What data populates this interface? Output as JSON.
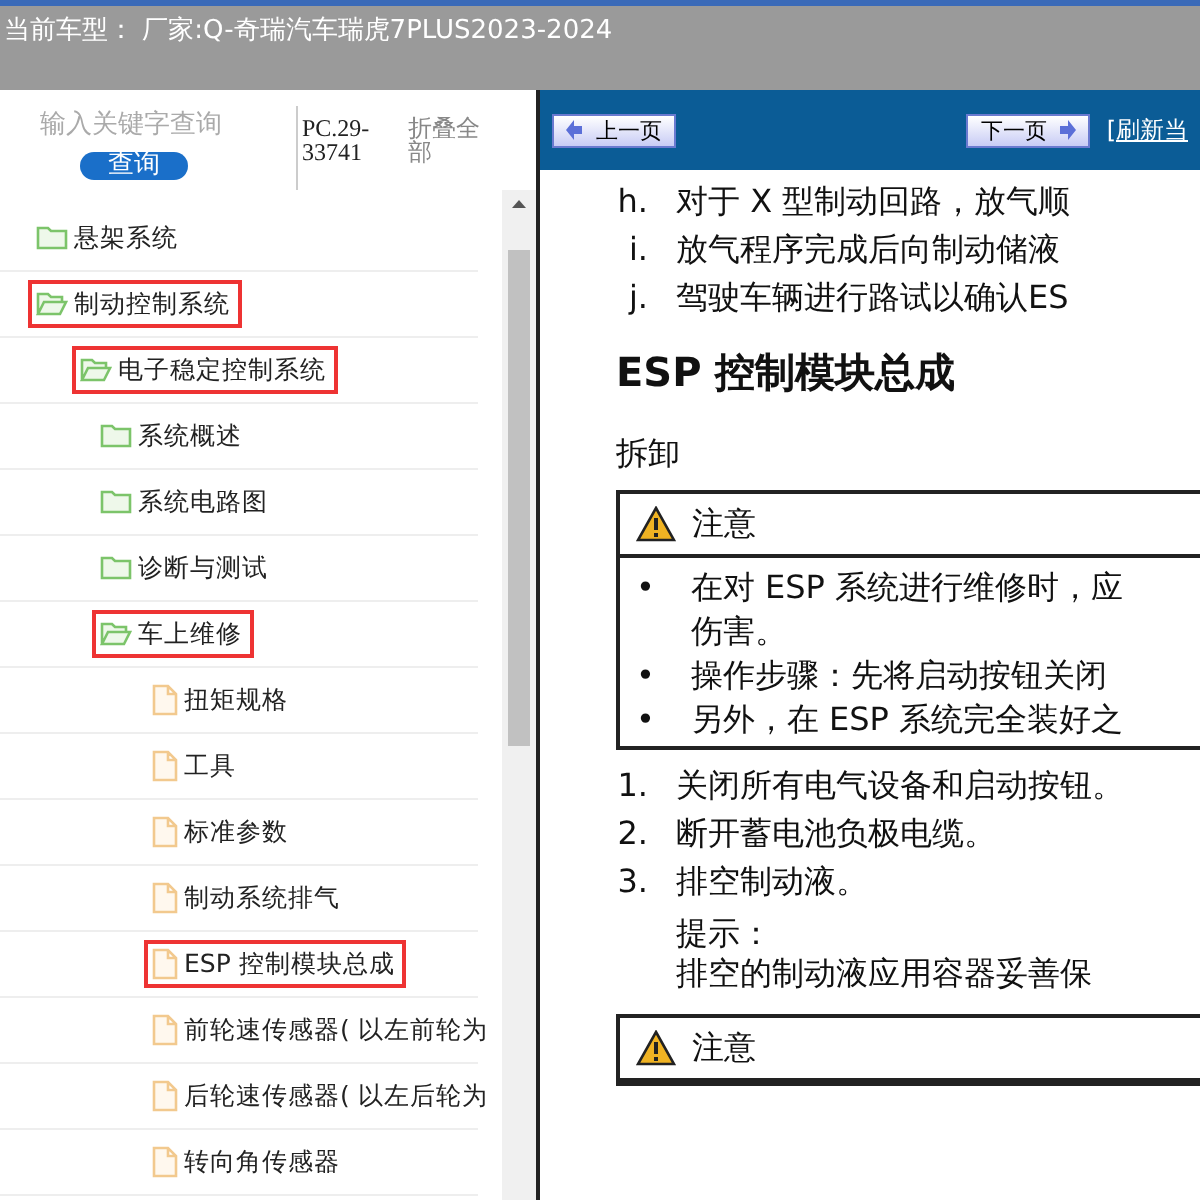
{
  "window": {
    "title": "当前车型：  厂家:Q-奇瑞汽车瑞虎7PLUS2023-2024"
  },
  "sidebar": {
    "search": {
      "placeholder": "输入关键字查询",
      "button": "查询"
    },
    "code": "PC.29-33741",
    "collapse_all": "折叠全部",
    "tree": [
      {
        "kind": "folder",
        "label": "悬架系统",
        "expanded": false,
        "highlighted": false
      },
      {
        "kind": "folder",
        "label": "制动控制系统",
        "expanded": true,
        "highlighted": true,
        "children": [
          {
            "kind": "folder",
            "label": "电子稳定控制系统",
            "expanded": true,
            "highlighted": true,
            "children": [
              {
                "kind": "folder",
                "label": "系统概述",
                "expanded": false,
                "highlighted": false
              },
              {
                "kind": "folder",
                "label": "系统电路图",
                "expanded": false,
                "highlighted": false
              },
              {
                "kind": "folder",
                "label": "诊断与测试",
                "expanded": false,
                "highlighted": false
              },
              {
                "kind": "folder",
                "label": "车上维修",
                "expanded": true,
                "highlighted": true,
                "children": [
                  {
                    "kind": "page",
                    "label": "扭矩规格",
                    "highlighted": false
                  },
                  {
                    "kind": "page",
                    "label": "工具",
                    "highlighted": false
                  },
                  {
                    "kind": "page",
                    "label": "标准参数",
                    "highlighted": false
                  },
                  {
                    "kind": "page",
                    "label": "制动系统排气",
                    "highlighted": false
                  },
                  {
                    "kind": "page",
                    "label": "ESP 控制模块总成",
                    "highlighted": true
                  },
                  {
                    "kind": "page",
                    "label": "前轮速传感器( 以左前轮为",
                    "highlighted": false
                  },
                  {
                    "kind": "page",
                    "label": "后轮速传感器( 以左后轮为",
                    "highlighted": false
                  },
                  {
                    "kind": "page",
                    "label": "转向角传感器",
                    "highlighted": false
                  }
                ]
              }
            ]
          }
        ]
      }
    ]
  },
  "toolbar": {
    "prev": "上一页",
    "next": "下一页",
    "refresh": "[刷新当"
  },
  "document": {
    "steps_before": [
      {
        "marker": "h.",
        "text": "对于 X 型制动回路，放气顺"
      },
      {
        "marker": "i.",
        "text": "放气程序完成后向制动储液"
      },
      {
        "marker": "j.",
        "text": "驾驶车辆进行路试以确认ES"
      }
    ],
    "heading": "ESP 控制模块总成",
    "section": "拆卸",
    "caution": {
      "title": "注意",
      "bullets": [
        {
          "marker": "•",
          "lines": [
            "在对 ESP 系统进行维修时，应",
            "伤害。"
          ]
        },
        {
          "marker": "•",
          "lines": [
            "操作步骤：先将启动按钮关闭"
          ]
        },
        {
          "marker": "•",
          "lines": [
            "另外，在 ESP 系统完全装好之"
          ]
        }
      ]
    },
    "steps": [
      {
        "marker": "1.",
        "text": "关闭所有电气设备和启动按钮。"
      },
      {
        "marker": "2.",
        "text": "断开蓄电池负极电缆。"
      },
      {
        "marker": "3.",
        "text": "排空制动液。"
      }
    ],
    "hint": {
      "title": "提示：",
      "text": "排空的制动液应用容器妥善保"
    },
    "caution2": {
      "title": "注意"
    }
  }
}
